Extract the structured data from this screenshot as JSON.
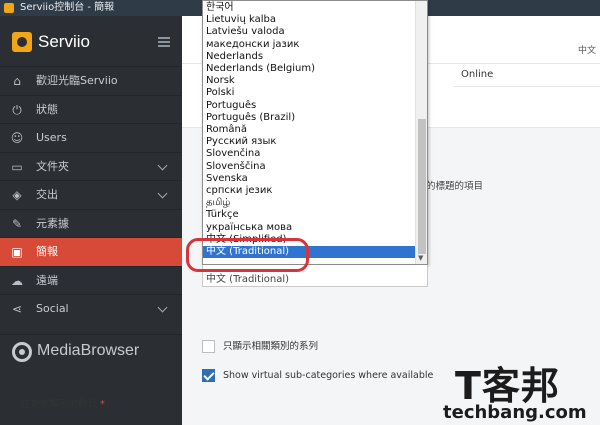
{
  "window": {
    "title": "Serviio控制台 - 簡報"
  },
  "sidebar": {
    "brand": "Serviio",
    "items": [
      {
        "label": "歡迎光臨Serviio",
        "icon": "home-icon",
        "has_chevron": false,
        "active": false
      },
      {
        "label": "狀態",
        "icon": "plug-icon",
        "has_chevron": false,
        "active": false
      },
      {
        "label": "Users",
        "icon": "user-icon",
        "has_chevron": false,
        "active": false
      },
      {
        "label": "文件夾",
        "icon": "folder-icon",
        "has_chevron": true,
        "active": false
      },
      {
        "label": "交出",
        "icon": "cube-icon",
        "has_chevron": true,
        "active": false
      },
      {
        "label": "元素據",
        "icon": "edit-icon",
        "has_chevron": false,
        "active": false
      },
      {
        "label": "簡報",
        "icon": "presentation-icon",
        "has_chevron": false,
        "active": true
      },
      {
        "label": "遠端",
        "icon": "cloud-icon",
        "has_chevron": false,
        "active": false
      },
      {
        "label": "Social",
        "icon": "share-icon",
        "has_chevron": true,
        "active": false
      }
    ],
    "media_browser": "MediaBrowser"
  },
  "topbar": {
    "language_indicator": "中文"
  },
  "status": {
    "online": "Online"
  },
  "settings": {
    "title_items_text": "的標題的項目",
    "show_related_series": {
      "label": "只顯示相關類別的系列",
      "checked": false
    },
    "show_virtual_subcategories": {
      "label": "Show virtual sub-categories where available",
      "checked": true
    },
    "dynamic_count_label": "在動態類別的數目",
    "required_marker": "*"
  },
  "language_dropdown": {
    "options": [
      "한국어",
      "Lietuvių kalba",
      "Latviešu valoda",
      "македонски јазик",
      "Nederlands",
      "Nederlands (Belgium)",
      "Norsk",
      "Polski",
      "Português",
      "Português (Brazil)",
      "Română",
      "Русский язык",
      "Slovenčina",
      "Slovenščina",
      "Svenska",
      "српски језик",
      "தமிழ்",
      "Türkçe",
      "українська мова",
      "中文 (Simplified)",
      "中文 (Traditional)"
    ],
    "selected": "中文 (Traditional)",
    "current_value": "中文 (Traditional)"
  },
  "watermark": {
    "brand_cn": "T客邦",
    "brand_en": "techbang.com"
  },
  "colors": {
    "accent": "#d64a37",
    "sidebar_bg": "#2b2f33",
    "selection": "#3074d0",
    "highlight_ring": "#d8323a",
    "brand_logo": "#f2a516"
  }
}
